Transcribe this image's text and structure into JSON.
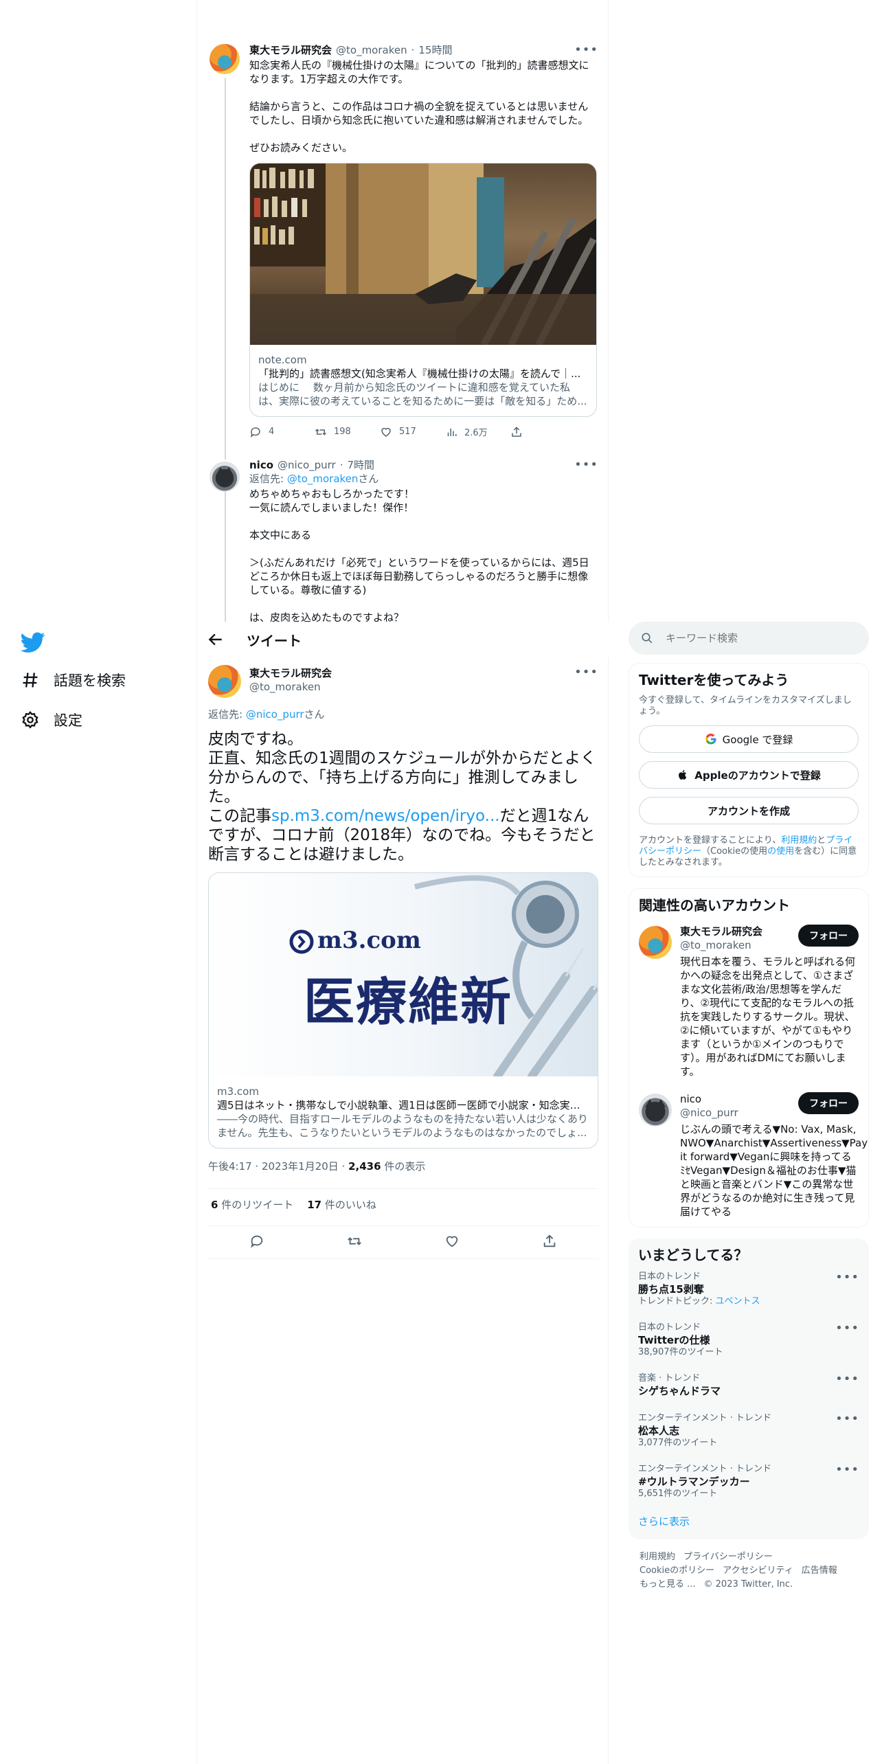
{
  "nav": {
    "explore_label": "話題を検索",
    "settings_label": "設定"
  },
  "thread": {
    "t1": {
      "name": "東大モラル研究会",
      "handle": "@to_moraken",
      "time": "15時間",
      "text": "知念実希人氏の『機械仕掛けの太陽』についての「批判的」読書感想文になります。1万字超えの大作です。\n\n結論から言うと、この作品はコロナ禍の全貌を捉えているとは思いませんでしたし、日頃から知念氏に抱いていた違和感は解消されませんでした。\n\nぜひお読みください。",
      "card": {
        "domain": "note.com",
        "title": "「批判的」読書感想文(知念実希人『機械仕掛けの太陽』を読んで｜...",
        "desc": "はじめに　 数ヶ月前から知念氏のツイートに違和感を覚えていた私は、実際に彼の考えていることを知るために一要は「敵を知る」ため..."
      },
      "replies": "4",
      "retweets": "198",
      "likes": "517",
      "views": "2.6万"
    },
    "t2": {
      "name": "nico",
      "handle": "@nico_purr",
      "time": "7時間",
      "reply_prefix": "返信先: ",
      "reply_to": "@to_moraken",
      "reply_suffix": "さん",
      "text": "めちゃめちゃおもしろかったです！\n一気に読んでしまいました！傑作！\n\n本文中にある\n\n＞(ふだんあれだけ「必死で」というワードを使っているからには、週5日どころか休日も返上でほぼ毎日勤務してらっしゃるのだろうと勝手に想像している。尊敬に値する)\n\nは、皮肉を込めたものですよね？"
    }
  },
  "topbar": {
    "title": "ツイート"
  },
  "main": {
    "name": "東大モラル研究会",
    "handle": "@to_moraken",
    "reply_prefix": "返信先: ",
    "reply_to": "@nico_purr",
    "reply_suffix": "さん",
    "text_a": "皮肉ですね。\n正直、知念氏の1週間のスケジュールが外からだとよく分からんので、「持ち上げる方向に」推測してみました。\nこの記事",
    "text_link": "sp.m3.com/news/open/iryo...",
    "text_b": "だと週1なんですが、コロナ前（2018年）なのでね。今もそうだと断言することは避けました。",
    "card": {
      "logo": "m3.com",
      "banner": "医療維新",
      "domain": "m3.com",
      "title": "週5日はネット・携帯なしで小説執筆、週1日は医師ー医師で小説家・知念実希...",
      "desc": "――今の時代、目指すロールモデルのようなものを持たない若い人は少なくありません。先生も、こうなりたいというモデルのようなものはなかったのでしょ..."
    },
    "timestamp": "午後4:17 · 2023年1月20日 · ",
    "views": "2,436",
    "views_label": " 件の表示",
    "retweets": "6",
    "retweets_label": " 件のリツイート",
    "likes": "17",
    "likes_label": " 件のいいね"
  },
  "search": {
    "placeholder": "キーワード検索"
  },
  "signup": {
    "title": "Twitterを使ってみよう",
    "subtitle": "今すぐ登録して、タイムラインをカスタマイズしましょう。",
    "google": "Google で登録",
    "apple": "Appleのアカウントで登録",
    "create": "アカウントを作成",
    "legal_a": "アカウントを登録することにより、",
    "legal_terms": "利用規約",
    "legal_and": "と",
    "legal_privacy": "プライバシーポリシー",
    "legal_cookie": "（Cookieの使用",
    "legal_b": "を含む）に同意したとみなされます。"
  },
  "related": {
    "title": "関連性の高いアカウント",
    "follow_label": "フォロー",
    "accounts": [
      {
        "name": "東大モラル研究会",
        "handle": "@to_moraken",
        "bio": "現代日本を覆う、モラルと呼ばれる何かへの疑念を出発点として、①さまざまな文化芸術/政治/思想等を学んだり、②現代にて支配的なモラルへの抵抗を実践したりするサークル。現状、②に傾いていますが、やがて①もやります（というか①メインのつもりです）。用があればDMにてお願いします。"
      },
      {
        "name": "nico",
        "handle": "@nico_purr",
        "bio": "じぶんの頭で考える▼No: Vax, Mask, NWO▼Anarchist▼Assertiveness▼Pay it forward▼Veganに興味を持ってる ﾐｾVegan▼Design＆福祉のお仕事▼猫と映画と音楽とバンド▼この異常な世界がどうなるのか絶対に生き残って見届けてやる"
      }
    ]
  },
  "trends": {
    "title": "いまどうしてる？",
    "items": [
      {
        "context": "日本のトレンド",
        "name": "勝ち点15剥奪",
        "extra_prefix": "トレンドトピック: ",
        "extra_link": "ユベントス"
      },
      {
        "context": "日本のトレンド",
        "name": "Twitterの仕様",
        "extra_prefix": "38,907件のツイート",
        "extra_link": ""
      },
      {
        "context": "音楽 · トレンド",
        "name": "シゲちゃんドラマ",
        "extra_prefix": "",
        "extra_link": ""
      },
      {
        "context": "エンターテインメント · トレンド",
        "name": "松本人志",
        "extra_prefix": "3,077件のツイート",
        "extra_link": ""
      },
      {
        "context": "エンターテインメント · トレンド",
        "name": "#ウルトラマンデッカー",
        "extra_prefix": "5,651件のツイート",
        "extra_link": ""
      }
    ],
    "show_more": "さらに表示"
  },
  "footer": {
    "terms": "利用規約",
    "privacy": "プライバシーポリシー",
    "cookie": "Cookieのポリシー",
    "accessibility": "アクセシビリティ",
    "ads": "広告情報",
    "more": "もっと見る ...",
    "copyright": "© 2023 Twitter, Inc."
  },
  "colors": {
    "accent": "#1d9bf0",
    "text": "#0f1419",
    "muted": "#536471",
    "border": "#cfd9de"
  }
}
